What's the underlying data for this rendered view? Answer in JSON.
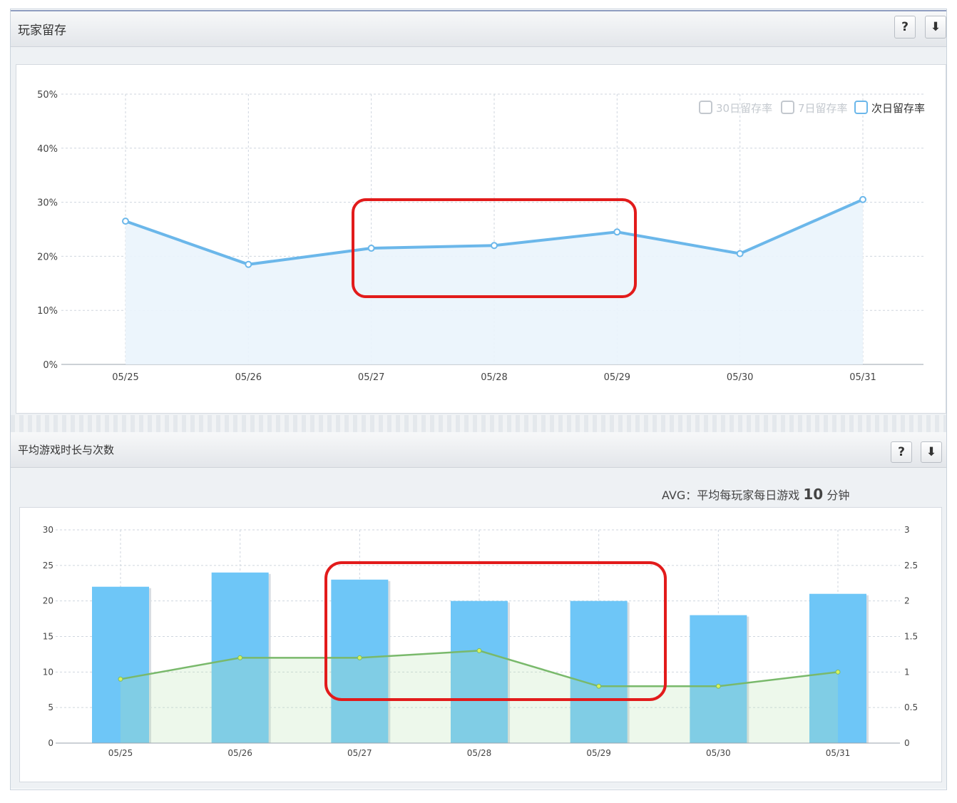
{
  "panels": [
    {
      "title": "玩家留存",
      "buttons": [
        "?",
        "⬇"
      ],
      "legend": [
        {
          "label": "30日留存率",
          "active": false
        },
        {
          "label": "7日留存率",
          "active": false
        },
        {
          "label": "次日留存率",
          "active": true
        }
      ]
    },
    {
      "title": "平均游戏时长与次数",
      "buttons": [
        "?",
        "⬇"
      ],
      "avg": {
        "prefix": "AVG：平均每玩家每日游戏",
        "value": "10",
        "unit": "分钟"
      }
    }
  ],
  "colors": {
    "line_blue": "#6bb7ea",
    "bar_blue": "#6ec6f7",
    "line_green": "#79b96b",
    "highlight_red": "#e21b1b"
  },
  "chart_data": [
    {
      "type": "area",
      "categories": [
        "05/25",
        "05/26",
        "05/27",
        "05/28",
        "05/29",
        "05/30",
        "05/31"
      ],
      "series": [
        {
          "name": "次日留存率",
          "values": [
            26.5,
            18.5,
            21.5,
            22,
            24.5,
            20.5,
            30.5
          ]
        }
      ],
      "yticks": [
        "0%",
        "10%",
        "20%",
        "30%",
        "40%",
        "50%"
      ],
      "ylim": [
        0,
        50
      ],
      "grid": true,
      "legend_position": "top-right"
    },
    {
      "type": "bar",
      "categories": [
        "05/25",
        "05/26",
        "05/27",
        "05/28",
        "05/29",
        "05/30",
        "05/31"
      ],
      "series": [
        {
          "type": "bar",
          "axis": "left",
          "values": [
            22,
            24,
            23,
            20,
            20,
            18,
            21
          ]
        },
        {
          "type": "area",
          "axis": "right",
          "values": [
            0.9,
            1.2,
            1.2,
            1.3,
            0.8,
            0.8,
            1.0
          ]
        }
      ],
      "yticks_left": [
        "0",
        "5",
        "10",
        "15",
        "20",
        "25",
        "30"
      ],
      "yticks_right": [
        "0",
        "0.5",
        "1",
        "1.5",
        "2",
        "2.5",
        "3"
      ],
      "ylim_left": [
        0,
        30
      ],
      "ylim_right": [
        0,
        3
      ],
      "grid": true
    }
  ]
}
